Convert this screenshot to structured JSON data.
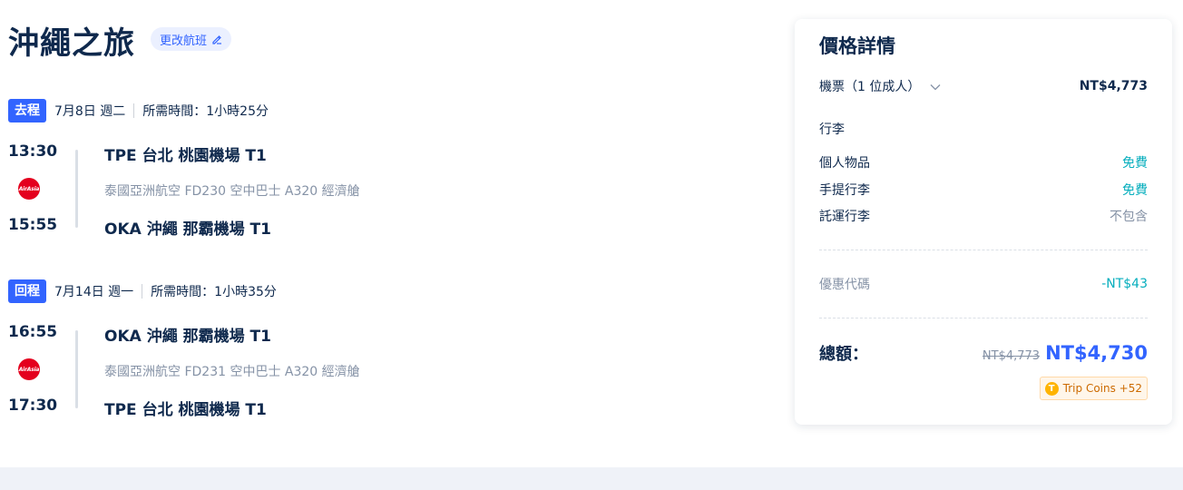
{
  "header": {
    "title": "沖繩之旅",
    "change_flight_label": "更改航班"
  },
  "outbound": {
    "tag": "去程",
    "date": "7月8日 週二",
    "duration": "所需時間：1小時25分",
    "depart_time": "13:30",
    "depart_place": "TPE 台北 桃園機場 T1",
    "flight_info": "泰國亞洲航空  FD230  空中巴士 A320  經濟艙",
    "arrive_time": "15:55",
    "arrive_place": "OKA 沖繩 那霸機場 T1",
    "airline_logo_text": "AirAsia"
  },
  "inbound": {
    "tag": "回程",
    "date": "7月14日 週一",
    "duration": "所需時間：1小時35分",
    "depart_time": "16:55",
    "depart_place": "OKA 沖繩 那霸機場 T1",
    "flight_info": "泰國亞洲航空  FD231  空中巴士 A320  經濟艙",
    "arrive_time": "17:30",
    "arrive_place": "TPE 台北 桃園機場 T1",
    "airline_logo_text": "AirAsia"
  },
  "price_panel": {
    "title": "價格詳情",
    "ticket_label": "機票（1 位成人）",
    "ticket_price": "NT$4,773",
    "baggage_heading": "行李",
    "baggage": [
      {
        "label": "個人物品",
        "value": "免費"
      },
      {
        "label": "手提行李",
        "value": "免費"
      },
      {
        "label": "託運行李",
        "value": "不包含"
      }
    ],
    "promo_label": "優惠代碼",
    "promo_value": "-NT$43",
    "total_label": "總額：",
    "original_price": "NT$4,773",
    "total_price": "NT$4,730",
    "coins_label": "Trip Coins +52",
    "coin_icon_text": "T"
  },
  "colors": {
    "primary": "#3264ff",
    "text": "#0f294d",
    "muted": "#8592a6",
    "free_green": "#06aebd",
    "airline_red": "#e4001e"
  }
}
